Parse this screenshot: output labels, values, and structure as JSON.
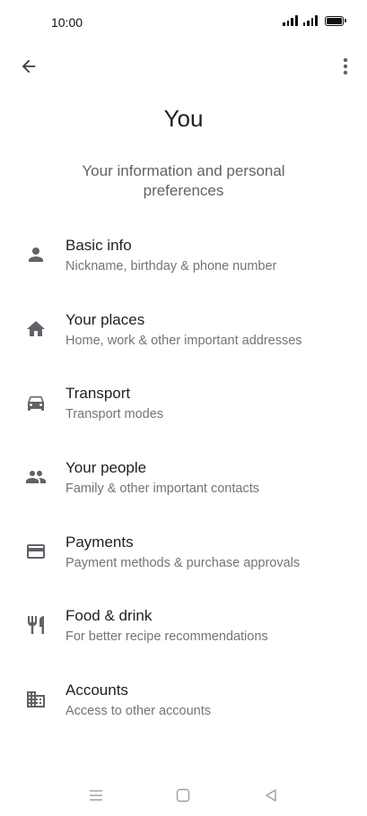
{
  "status_bar": {
    "time": "10:00"
  },
  "header": {
    "title": "You",
    "subtitle": "Your information and personal preferences"
  },
  "menu": [
    {
      "title": "Basic info",
      "description": "Nickname, birthday & phone number",
      "icon": "person-icon"
    },
    {
      "title": "Your places",
      "description": "Home, work & other important addresses",
      "icon": "home-icon"
    },
    {
      "title": "Transport",
      "description": "Transport modes",
      "icon": "car-icon"
    },
    {
      "title": "Your people",
      "description": "Family & other important contacts",
      "icon": "people-icon"
    },
    {
      "title": "Payments",
      "description": "Payment methods & purchase approvals",
      "icon": "credit-card-icon"
    },
    {
      "title": "Food & drink",
      "description": "For better recipe recommendations",
      "icon": "restaurant-icon"
    },
    {
      "title": "Accounts",
      "description": "Access to other accounts",
      "icon": "building-icon"
    }
  ],
  "colors": {
    "icon": "#5f6368",
    "title_text": "#202124",
    "secondary_text": "#70757a"
  }
}
